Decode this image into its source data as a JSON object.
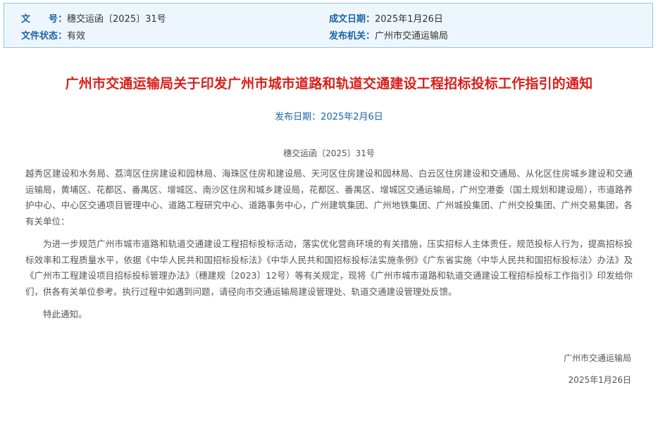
{
  "meta": {
    "doc_no_label": "文　　号：",
    "doc_no_value": "穗交运函〔2025〕31号",
    "date_label": "成文日期：",
    "date_value": "2025年1月26日",
    "status_label": "文件状态：",
    "status_value": "有效",
    "issuer_label": "发布机关：",
    "issuer_value": "广州市交通运输局"
  },
  "article": {
    "title": "广州市交通运输局关于印发广州市城市道路和轨道交通建设工程招标投标工作指引的通知",
    "publish_date": "发布日期：2025年2月6日",
    "doc_number": "穗交运函〔2025〕31号",
    "recipients": "越秀区建设和水务局、荔湾区住房建设和园林局、海珠区住房和建设局、天河区住房建设和园林局、白云区住房建设和交通局、从化区住房城乡建设和交通运输局，黄埔区、花都区、番禺区、增城区、南沙区住房和城乡建设局，花都区、番禺区、增城区交通运输局，广州空港委（国土规划和建设局），市道路养护中心、中心区交通项目管理中心、道路工程研究中心、道路事务中心，广州建筑集团、广州地铁集团、广州城投集团、广州交投集团、广州交易集团，各有关单位：",
    "body": "为进一步规范广州市城市道路和轨道交通建设工程招标投标活动，落实优化营商环境的有关措施，压实招标人主体责任，规范投标人行为，提高招标投标效率和工程质量水平，依据《中华人民共和国招标投标法》《中华人民共和国招标投标法实施条例》《广东省实施〈中华人民共和国招标投标法〉办法》及《广州市工程建设项目招标投标管理办法》（穗建规〔2023〕12号）等有关规定，现将《广州市城市道路和轨道交通建设工程招标投标工作指引》印发给你们，供各有关单位参考。执行过程中如遇到问题，请径向市交通运输局建设管理处、轨道交通建设管理处反馈。",
    "closing": "特此通知。",
    "signature": "广州市交通运输局",
    "sign_date": "2025年1月26日"
  }
}
